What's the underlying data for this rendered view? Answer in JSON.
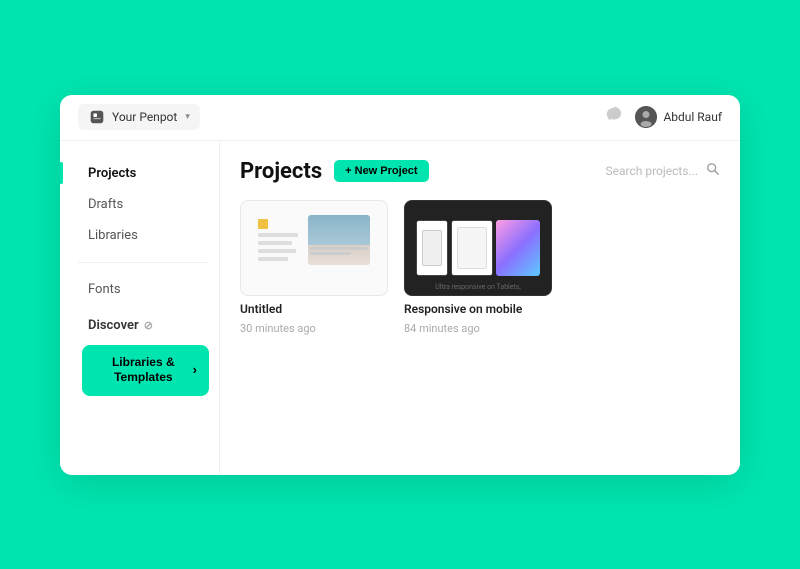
{
  "header": {
    "workspace_label": "Your Penpot",
    "user_name": "Abdul Rauf"
  },
  "sidebar": {
    "items": [
      {
        "id": "projects",
        "label": "Projects",
        "active": true
      },
      {
        "id": "drafts",
        "label": "Drafts",
        "active": false
      },
      {
        "id": "libraries",
        "label": "Libraries",
        "active": false
      },
      {
        "id": "fonts",
        "label": "Fonts",
        "active": false
      }
    ],
    "discover": {
      "label": "Discover",
      "libraries_btn": "Libraries & Templates",
      "arrow": "›"
    }
  },
  "content": {
    "page_title": "Projects",
    "new_project_btn": "+ New Project",
    "search_placeholder": "Search projects...",
    "projects": [
      {
        "id": "untitled",
        "name": "Untitled",
        "time": "30 minutes ago",
        "thumb_type": "light"
      },
      {
        "id": "responsive-mobile",
        "name": "Responsive on mobile",
        "time": "84 minutes ago",
        "thumb_type": "dark",
        "caption": "Ultra responsive on Tablets,"
      }
    ]
  },
  "colors": {
    "accent": "#00e5b0",
    "bg": "#ffffff",
    "text_primary": "#111111",
    "text_secondary": "#555555",
    "text_muted": "#aaaaaa"
  }
}
